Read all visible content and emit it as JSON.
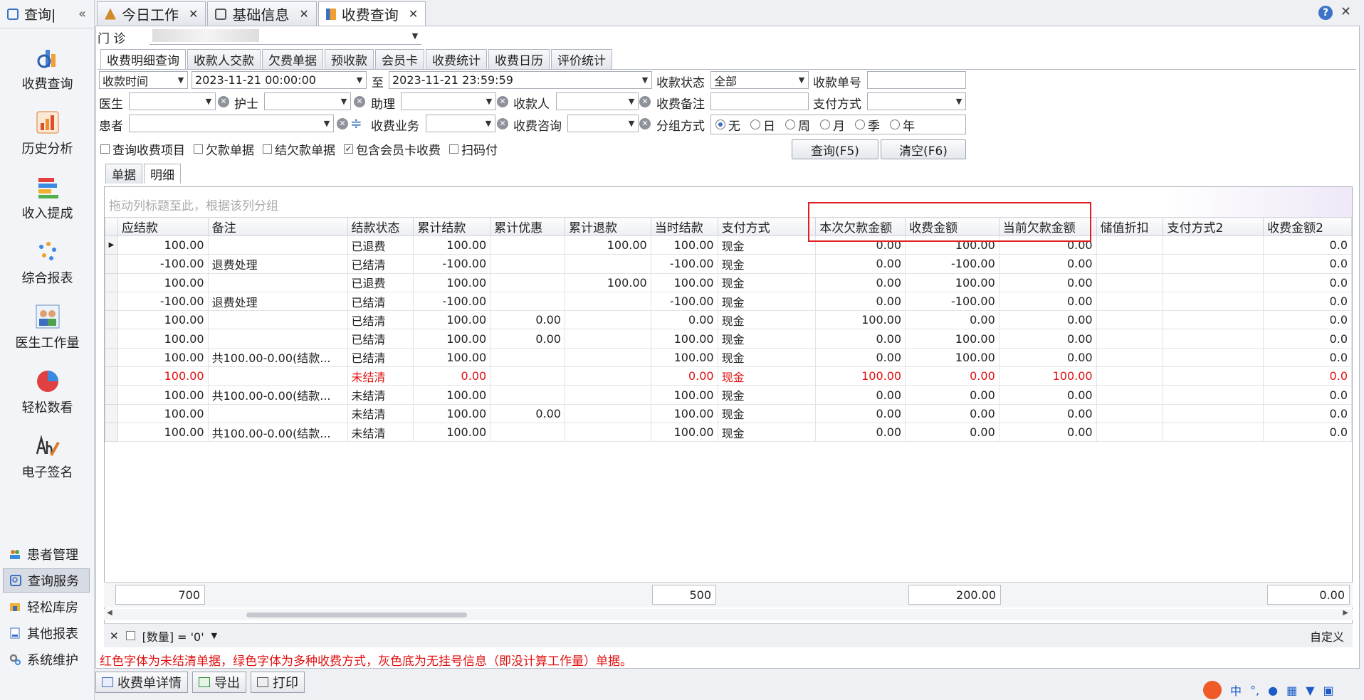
{
  "sidebar": {
    "header_title": "查询|",
    "collapse_glyph": "«",
    "big_items": [
      {
        "label": "收费查询",
        "icon": "charge-query-icon"
      },
      {
        "label": "历史分析",
        "icon": "history-chart-icon"
      },
      {
        "label": "收入提成",
        "icon": "income-bars-icon"
      },
      {
        "label": "综合报表",
        "icon": "scatter-report-icon"
      },
      {
        "label": "医生工作量",
        "icon": "doctor-workload-icon"
      },
      {
        "label": "轻松数看",
        "icon": "pie-chart-icon"
      },
      {
        "label": "电子签名",
        "icon": "e-signature-icon"
      }
    ],
    "small_items": [
      {
        "label": "患者管理",
        "icon": "patients-icon"
      },
      {
        "label": "查询服务",
        "icon": "query-service-icon"
      },
      {
        "label": "轻松库房",
        "icon": "warehouse-icon"
      },
      {
        "label": "其他报表",
        "icon": "other-reports-icon"
      },
      {
        "label": "系统维护",
        "icon": "system-gear-icon"
      }
    ]
  },
  "doc_tabs": [
    {
      "label": "今日工作",
      "icon": "today-work-icon"
    },
    {
      "label": "基础信息",
      "icon": "basic-info-icon"
    },
    {
      "label": "收费查询",
      "icon": "charge-query-icon"
    }
  ],
  "clinic": {
    "label": "门    诊"
  },
  "sub_tabs": [
    "收费明细查询",
    "收款人交款",
    "欠费单据",
    "预收款",
    "会员卡",
    "收费统计",
    "收费日历",
    "评价统计"
  ],
  "filters": {
    "time_type": "收款时间",
    "start": "2023-11-21 00:00:00",
    "to_label": "至",
    "end": "2023-11-21 23:59:59",
    "status_label": "收款状态",
    "status_value": "全部",
    "receipt_no_label": "收款单号",
    "doctor_label": "医生",
    "nurse_label": "护士",
    "assistant_label": "助理",
    "payee_label": "收款人",
    "charge_note_label": "收费备注",
    "pay_method_label": "支付方式",
    "patient_label": "患者",
    "business_label": "收费业务",
    "consult_label": "收费咨询",
    "group_label": "分组方式",
    "group_options": [
      "无",
      "日",
      "周",
      "月",
      "季",
      "年"
    ],
    "checks": [
      {
        "label": "查询收费项目",
        "checked": false
      },
      {
        "label": "欠款单据",
        "checked": false
      },
      {
        "label": "结欠款单据",
        "checked": false
      },
      {
        "label": "包含会员卡收费",
        "checked": true
      },
      {
        "label": "扫码付",
        "checked": false
      }
    ],
    "query_button": "查询(F5)",
    "clear_button": "清空(F6)"
  },
  "view_tabs": [
    "单据",
    "明细"
  ],
  "grid": {
    "group_hint": "拖动列标题至此，根据该列分组",
    "columns": [
      "应结款",
      "备注",
      "结款状态",
      "累计结款",
      "累计优惠",
      "累计退款",
      "当时结款",
      "支付方式",
      "本次欠款金额",
      "收费金额",
      "当前欠款金额",
      "储值折扣",
      "支付方式2",
      "收费金额2"
    ],
    "rows": [
      {
        "cells": [
          "100.00",
          "",
          "已退费",
          "100.00",
          "",
          "100.00",
          "100.00",
          "现金",
          "0.00",
          "100.00",
          "0.00",
          "",
          "",
          "0.0"
        ],
        "red": false
      },
      {
        "cells": [
          "-100.00",
          "退费处理",
          "已结清",
          "-100.00",
          "",
          "",
          "-100.00",
          "现金",
          "0.00",
          "-100.00",
          "0.00",
          "",
          "",
          "0.0"
        ],
        "red": false
      },
      {
        "cells": [
          "100.00",
          "",
          "已退费",
          "100.00",
          "",
          "100.00",
          "100.00",
          "现金",
          "0.00",
          "100.00",
          "0.00",
          "",
          "",
          "0.0"
        ],
        "red": false
      },
      {
        "cells": [
          "-100.00",
          "退费处理",
          "已结清",
          "-100.00",
          "",
          "",
          "-100.00",
          "现金",
          "0.00",
          "-100.00",
          "0.00",
          "",
          "",
          "0.0"
        ],
        "red": false
      },
      {
        "cells": [
          "100.00",
          "",
          "已结清",
          "100.00",
          "0.00",
          "",
          "0.00",
          "现金",
          "100.00",
          "0.00",
          "0.00",
          "",
          "",
          "0.0"
        ],
        "red": false
      },
      {
        "cells": [
          "100.00",
          "",
          "已结清",
          "100.00",
          "0.00",
          "",
          "100.00",
          "现金",
          "0.00",
          "100.00",
          "0.00",
          "",
          "",
          "0.0"
        ],
        "red": false
      },
      {
        "cells": [
          "100.00",
          "共100.00-0.00(结款...",
          "已结清",
          "100.00",
          "",
          "",
          "100.00",
          "现金",
          "0.00",
          "100.00",
          "0.00",
          "",
          "",
          "0.0"
        ],
        "red": false
      },
      {
        "cells": [
          "100.00",
          "",
          "未结清",
          "0.00",
          "",
          "",
          "0.00",
          "现金",
          "100.00",
          "0.00",
          "100.00",
          "",
          "",
          "0.0"
        ],
        "red": true
      },
      {
        "cells": [
          "100.00",
          "共100.00-0.00(结款...",
          "未结清",
          "100.00",
          "",
          "",
          "100.00",
          "现金",
          "0.00",
          "0.00",
          "0.00",
          "",
          "",
          "0.0"
        ],
        "red": false
      },
      {
        "cells": [
          "100.00",
          "",
          "未结清",
          "100.00",
          "0.00",
          "",
          "100.00",
          "现金",
          "0.00",
          "0.00",
          "0.00",
          "",
          "",
          "0.0"
        ],
        "red": false
      },
      {
        "cells": [
          "100.00",
          "共100.00-0.00(结款...",
          "未结清",
          "100.00",
          "",
          "",
          "100.00",
          "现金",
          "0.00",
          "0.00",
          "0.00",
          "",
          "",
          "0.0"
        ],
        "red": false
      }
    ],
    "totals": {
      "due": "700",
      "paid_now": "500",
      "charge_amount": "200.00",
      "charge_amount2": "0.00"
    },
    "filter_text": "[数量] = '0'",
    "customize": "自定义"
  },
  "legend": "红色字体为未结清单据，绿色字体为多种收费方式，灰色底为无挂号信息（即没计算工作量）单据。",
  "bottom_buttons": [
    "收费单详情",
    "导出",
    "打印"
  ],
  "tray": {
    "ime": "中"
  }
}
